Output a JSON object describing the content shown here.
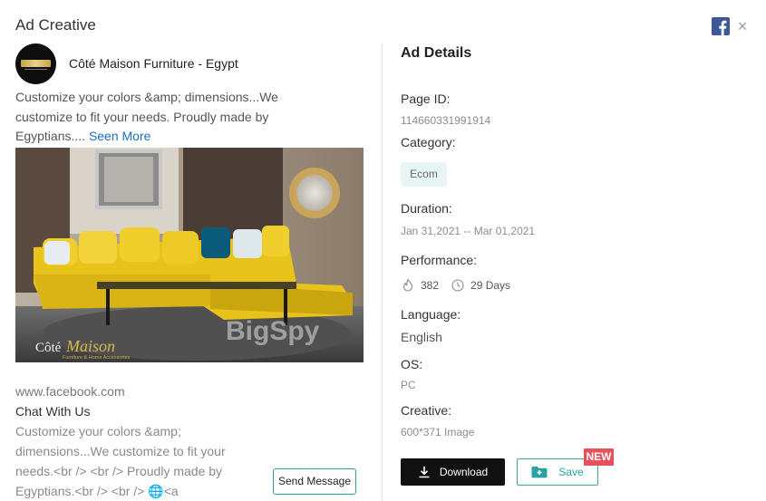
{
  "header": {
    "title": "Ad Creative",
    "social_icon": "facebook-icon",
    "close_icon": "close-icon",
    "close_glyph": "×"
  },
  "advertiser": {
    "name": "Côté Maison Furniture - Egypt",
    "avatar_icon": "brand-logo"
  },
  "ad": {
    "text": "Customize your colors &amp; dimensions...We customize to fit your needs. Proudly made by Egyptians.... ",
    "seen_more": "Seen More",
    "image_logo_word1": "Côté",
    "image_logo_word2": "Maison",
    "image_logo_tagline": "Furniture & Home Accessories",
    "image_watermark": "BigSpy",
    "link_url": "www.facebook.com",
    "cta_title": "Chat With Us",
    "link_description": "Customize your colors &amp; dimensions...We customize to fit your needs.<br /> <br /> Proudly made by Egyptians.<br /> <br /> 🌐<a",
    "send_message": "Send Message"
  },
  "details": {
    "title": "Ad Details",
    "page_id_label": "Page ID:",
    "page_id_value": "114660331991914",
    "category_label": "Category:",
    "category_tag": "Ecom",
    "duration_label": "Duration:",
    "duration_value": "Jan 31,2021 -- Mar 01,2021",
    "performance_label": "Performance:",
    "performance_likes": "382",
    "performance_days": "29 Days",
    "language_label": "Language:",
    "language_value": "English",
    "os_label": "OS:",
    "os_value": "PC",
    "creative_label": "Creative:",
    "creative_value": "600*371 Image"
  },
  "actions": {
    "download": "Download",
    "save": "Save",
    "new_badge": "NEW"
  },
  "colors": {
    "accent": "#2aa4a0",
    "facebook": "#3b5998",
    "badge": "#e8505b",
    "download_bg": "#111111"
  }
}
